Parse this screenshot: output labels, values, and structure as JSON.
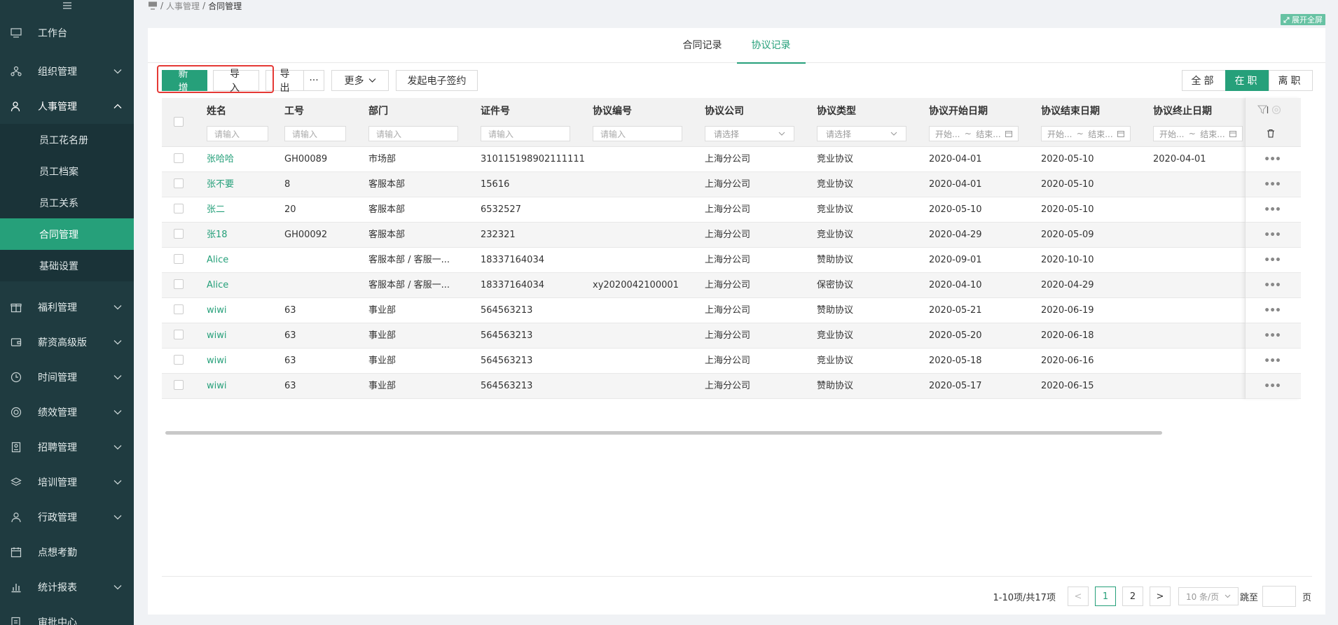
{
  "breadcrumb": {
    "sep1": "/",
    "parent": "人事管理",
    "sep2": "/",
    "current": "合同管理"
  },
  "fullscreen_label": "展开全屏",
  "sidebar": {
    "items": [
      {
        "label": "工作台",
        "icon": "monitor-icon"
      },
      {
        "label": "组织管理",
        "icon": "org-icon"
      },
      {
        "label": "人事管理",
        "icon": "person-icon"
      },
      {
        "label": "福利管理",
        "icon": "gift-icon"
      },
      {
        "label": "薪资高级版",
        "icon": "wallet-icon"
      },
      {
        "label": "时间管理",
        "icon": "clock-icon"
      },
      {
        "label": "绩效管理",
        "icon": "target-icon"
      },
      {
        "label": "招聘管理",
        "icon": "badge-icon"
      },
      {
        "label": "培训管理",
        "icon": "layers-icon"
      },
      {
        "label": "行政管理",
        "icon": "admin-icon"
      },
      {
        "label": "点想考勤",
        "icon": "calendar-icon"
      },
      {
        "label": "统计报表",
        "icon": "bar-chart-icon"
      },
      {
        "label": "审批中心",
        "icon": "approve-icon"
      }
    ],
    "subitems": [
      "员工花名册",
      "员工档案",
      "员工关系",
      "合同管理",
      "基础设置"
    ]
  },
  "tabs": [
    "合同记录",
    "协议记录"
  ],
  "toolbar": {
    "add": "新增",
    "import": "导入",
    "export": "导出",
    "dots": "···",
    "more": "更多",
    "esign": "发起电子签约"
  },
  "filter_seg": [
    "全部",
    "在职",
    "离职"
  ],
  "columns": [
    "姓名",
    "工号",
    "部门",
    "证件号",
    "协议编号",
    "协议公司",
    "协议类型",
    "协议开始日期",
    "协议结束日期",
    "协议终止日期"
  ],
  "filters": {
    "input_placeholder": "请输入",
    "select_placeholder": "请选择",
    "range_start": "开始...",
    "range_tilde": "~",
    "range_end": "结束..."
  },
  "rows": [
    [
      "张哈哈",
      "GH00089",
      "市场部",
      "310115198902111111",
      "",
      "上海分公司",
      "竞业协议",
      "2020-04-01",
      "2020-05-10",
      "2020-04-01"
    ],
    [
      "张不要",
      "8",
      "客服本部",
      "15616",
      "",
      "上海分公司",
      "竞业协议",
      "2020-04-01",
      "2020-05-10",
      ""
    ],
    [
      "张二",
      "20",
      "客服本部",
      "6532527",
      "",
      "上海分公司",
      "竞业协议",
      "2020-05-10",
      "2020-05-10",
      ""
    ],
    [
      "张18",
      "GH00092",
      "客服本部",
      "232321",
      "",
      "上海分公司",
      "竞业协议",
      "2020-04-29",
      "2020-05-09",
      ""
    ],
    [
      "Alice",
      "",
      "客服本部 / 客服一...",
      "18337164034",
      "",
      "上海分公司",
      "赞助协议",
      "2020-09-01",
      "2020-10-10",
      ""
    ],
    [
      "Alice",
      "",
      "客服本部 / 客服一...",
      "18337164034",
      "xy2020042100001",
      "上海分公司",
      "保密协议",
      "2020-04-10",
      "2020-04-29",
      ""
    ],
    [
      "wiwi",
      "63",
      "事业部",
      "564563213",
      "",
      "上海分公司",
      "赞助协议",
      "2020-05-21",
      "2020-06-19",
      ""
    ],
    [
      "wiwi",
      "63",
      "事业部",
      "564563213",
      "",
      "上海分公司",
      "竞业协议",
      "2020-05-20",
      "2020-06-18",
      ""
    ],
    [
      "wiwi",
      "63",
      "事业部",
      "564563213",
      "",
      "上海分公司",
      "竞业协议",
      "2020-05-18",
      "2020-06-16",
      ""
    ],
    [
      "wiwi",
      "63",
      "事业部",
      "564563213",
      "",
      "上海分公司",
      "赞助协议",
      "2020-05-17",
      "2020-06-15",
      ""
    ]
  ],
  "row_action": "•••",
  "pager": {
    "total": "1-10项/共17项",
    "prev": "<",
    "pages": [
      "1",
      "2"
    ],
    "next": ">",
    "size": "10 条/页",
    "jump": "跳至",
    "unit": "页"
  },
  "colors": {
    "accent": "#26a07a",
    "sidebar": "#1f3b40",
    "highlight": "#e53935"
  }
}
